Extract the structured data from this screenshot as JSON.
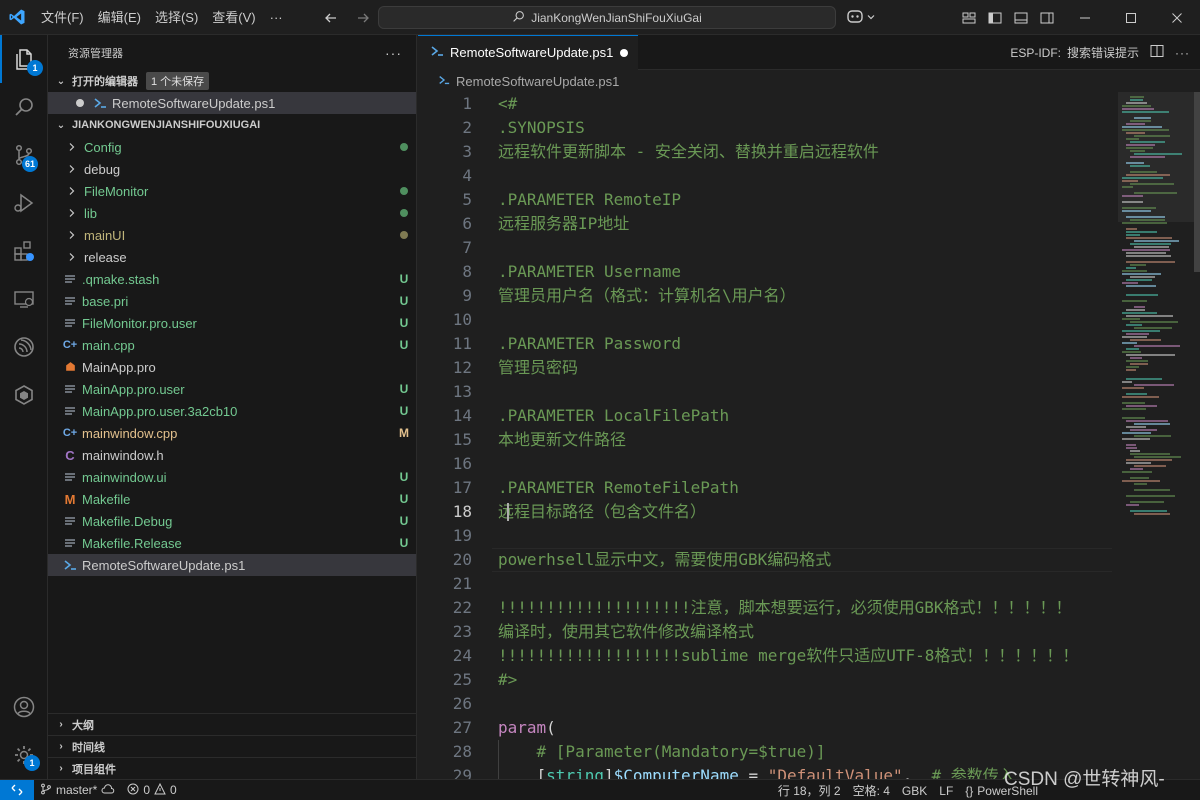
{
  "titlebar": {
    "menus": [
      "文件(F)",
      "编辑(E)",
      "选择(S)",
      "查看(V)"
    ],
    "more": "···",
    "search_text": "JianKongWenJianShiFouXiuGai"
  },
  "activity": {
    "explorer_badge": "1",
    "scm_badge": "61",
    "settings_badge": "1"
  },
  "sidebar": {
    "title": "资源管理器",
    "more": "···",
    "open_editors": {
      "label": "打开的编辑器",
      "badge": "1 个未保存",
      "file": "RemoteSoftwareUpdate.ps1"
    },
    "workspace": "JIANKONGWENJIANSHIFOUXIUGAI",
    "items": [
      {
        "label": "Config",
        "kind": "folder",
        "color": "#73c991",
        "status": "dot",
        "status_color": "#4f8f5f"
      },
      {
        "label": "debug",
        "kind": "folder",
        "color": "#cccccc",
        "status": "",
        "status_color": ""
      },
      {
        "label": "FileMonitor",
        "kind": "folder",
        "color": "#73c991",
        "status": "dot",
        "status_color": "#4f8f5f"
      },
      {
        "label": "lib",
        "kind": "folder",
        "color": "#73c991",
        "status": "dot",
        "status_color": "#4f8f5f"
      },
      {
        "label": "mainUI",
        "kind": "folder",
        "color": "#c0b57a",
        "status": "dot",
        "status_color": "#7f7a52"
      },
      {
        "label": "release",
        "kind": "folder",
        "color": "#cccccc",
        "status": "",
        "status_color": ""
      },
      {
        "label": ".qmake.stash",
        "kind": "file",
        "icon": "lines",
        "color": "#73c991",
        "status": "U",
        "status_color": "#73c991"
      },
      {
        "label": "base.pri",
        "kind": "file",
        "icon": "lines",
        "color": "#73c991",
        "status": "U",
        "status_color": "#73c991"
      },
      {
        "label": "FileMonitor.pro.user",
        "kind": "file",
        "icon": "lines",
        "color": "#73c991",
        "status": "U",
        "status_color": "#73c991"
      },
      {
        "label": "main.cpp",
        "kind": "file",
        "icon": "cpp",
        "color": "#73c991",
        "status": "U",
        "status_color": "#73c991"
      },
      {
        "label": "MainApp.pro",
        "kind": "file",
        "icon": "qt",
        "color": "#cccccc",
        "status": "",
        "status_color": ""
      },
      {
        "label": "MainApp.pro.user",
        "kind": "file",
        "icon": "lines",
        "color": "#73c991",
        "status": "U",
        "status_color": "#73c991"
      },
      {
        "label": "MainApp.pro.user.3a2cb10",
        "kind": "file",
        "icon": "lines",
        "color": "#73c991",
        "status": "U",
        "status_color": "#73c991"
      },
      {
        "label": "mainwindow.cpp",
        "kind": "file",
        "icon": "cpp",
        "color": "#e2c08d",
        "status": "M",
        "status_color": "#e2c08d"
      },
      {
        "label": "mainwindow.h",
        "kind": "file",
        "icon": "c",
        "color": "#cccccc",
        "status": "",
        "status_color": ""
      },
      {
        "label": "mainwindow.ui",
        "kind": "file",
        "icon": "lines",
        "color": "#73c991",
        "status": "U",
        "status_color": "#73c991"
      },
      {
        "label": "Makefile",
        "kind": "file",
        "icon": "make",
        "color": "#73c991",
        "status": "U",
        "status_color": "#73c991"
      },
      {
        "label": "Makefile.Debug",
        "kind": "file",
        "icon": "lines",
        "color": "#73c991",
        "status": "U",
        "status_color": "#73c991"
      },
      {
        "label": "Makefile.Release",
        "kind": "file",
        "icon": "lines",
        "color": "#73c991",
        "status": "U",
        "status_color": "#73c991"
      },
      {
        "label": "RemoteSoftwareUpdate.ps1",
        "kind": "file",
        "icon": "ps",
        "color": "#cccccc",
        "status": "",
        "status_color": "",
        "selected": true
      }
    ],
    "outline": "大纲",
    "timeline": "时间线",
    "project_components": "项目组件"
  },
  "editor": {
    "tab_label": "RemoteSoftwareUpdate.ps1",
    "esp_idf": "ESP-IDF:",
    "search_error": "搜索错误提示",
    "breadcrumb": "RemoteSoftwareUpdate.ps1",
    "current_line": 18,
    "lines": [
      [
        {
          "t": "<#",
          "c": "com"
        }
      ],
      [
        {
          "t": ".SYNOPSIS",
          "c": "com"
        }
      ],
      [
        {
          "t": "远程软件更新脚本 - 安全关闭、替换并重启远程软件",
          "c": "com"
        }
      ],
      [],
      [
        {
          "t": ".PARAMETER RemoteIP",
          "c": "com"
        }
      ],
      [
        {
          "t": "远程服务器IP地址",
          "c": "com"
        }
      ],
      [],
      [
        {
          "t": ".PARAMETER Username",
          "c": "com"
        }
      ],
      [
        {
          "t": "管理员用户名（格式：计算机名\\用户名）",
          "c": "com"
        }
      ],
      [],
      [
        {
          "t": ".PARAMETER Password",
          "c": "com"
        }
      ],
      [
        {
          "t": "管理员密码",
          "c": "com"
        }
      ],
      [],
      [
        {
          "t": ".PARAMETER LocalFilePath",
          "c": "com"
        }
      ],
      [
        {
          "t": "本地更新文件路径",
          "c": "com"
        }
      ],
      [],
      [
        {
          "t": ".PARAMETER RemoteFilePath",
          "c": "com"
        }
      ],
      [
        {
          "t": "远程目标路径（包含文件名）",
          "c": "com"
        }
      ],
      [],
      [
        {
          "t": "powerhsell显示中文，需要使用GBK编码格式",
          "c": "com"
        }
      ],
      [],
      [
        {
          "t": "!!!!!!!!!!!!!!!!!!!!注意，脚本想要运行，必须使用GBK格式！！！！！！",
          "c": "com"
        }
      ],
      [
        {
          "t": "编译时，使用其它软件修改编译格式",
          "c": "com"
        }
      ],
      [
        {
          "t": "!!!!!!!!!!!!!!!!!!!sublime merge软件只适应UTF-8格式！！！！！！！",
          "c": "com"
        }
      ],
      [
        {
          "t": "#>",
          "c": "com"
        }
      ],
      [],
      [
        {
          "t": "param",
          "c": "kw"
        },
        {
          "t": "(",
          "c": "plain"
        }
      ],
      [
        {
          "t": "    # [Parameter(Mandatory=$true)]",
          "c": "com"
        }
      ],
      [
        {
          "t": "    [",
          "c": "plain"
        },
        {
          "t": "string",
          "c": "type"
        },
        {
          "t": "]",
          "c": "plain"
        },
        {
          "t": "$ComputerName",
          "c": "var"
        },
        {
          "t": " = ",
          "c": "plain"
        },
        {
          "t": "\"DefaultValue\"",
          "c": "str"
        },
        {
          "t": ",  ",
          "c": "plain"
        },
        {
          "t": "# 参数传入",
          "c": "com"
        }
      ]
    ]
  },
  "status": {
    "branch": "master*",
    "errors": "0",
    "warnings": "0",
    "position": "行 18，列 2",
    "spaces": "空格: 4",
    "encoding": "GBK",
    "eol": "LF",
    "language": "PowerShell",
    "watermark": "CSDN @世转神风-"
  }
}
